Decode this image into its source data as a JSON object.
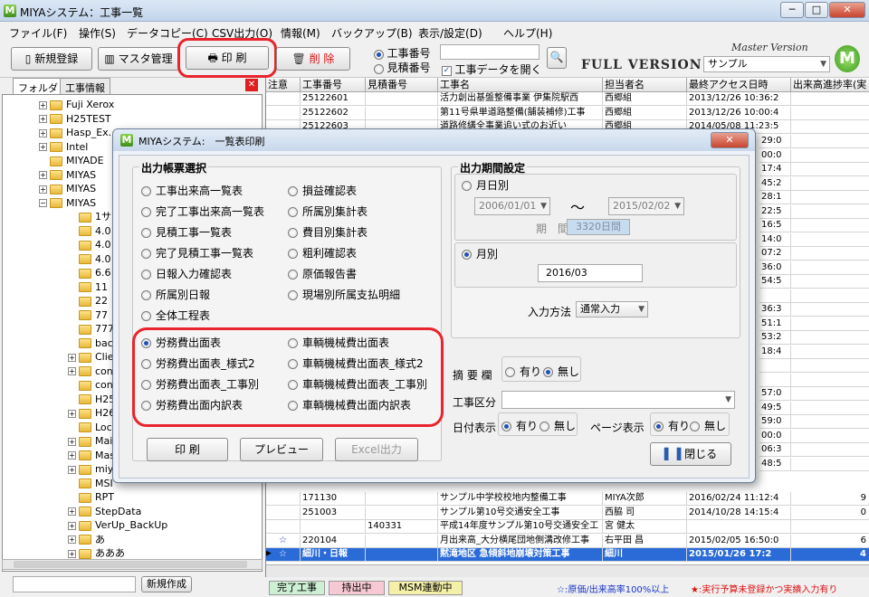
{
  "window": {
    "title": "MIYAシステム：工事一覧",
    "app_icon": "M"
  },
  "menu": [
    "ファイル(F)",
    "操作(S)",
    "データコピー(C)",
    "CSV出力(O)",
    "情報(M)",
    "バックアップ(B)",
    "表示/設定(D)",
    "ヘルプ(H)"
  ],
  "toolbar": {
    "new_label": "新規登録",
    "master_label": "マスタ管理",
    "print_label": "印 刷",
    "delete_label": "削 除",
    "radio_koji": "工事番号",
    "radio_mitsumori": "見積番号",
    "open_check_label": "工事データを開く",
    "search_value": "",
    "brand_top": "Master Version",
    "brand_main": "FULL VERSION",
    "company_value": "サンプル"
  },
  "left": {
    "tabs": [
      "フォルダ",
      "工事情報"
    ],
    "tree": [
      {
        "label": "Fuji Xerox",
        "pm": "+"
      },
      {
        "label": "H25TEST",
        "pm": "+"
      },
      {
        "label": "Hasp_Ex...",
        "pm": "+"
      },
      {
        "label": "Intel",
        "pm": "+"
      },
      {
        "label": "MIYADE",
        "pm": ""
      },
      {
        "label": "MIYAS",
        "pm": "+"
      },
      {
        "label": "MIYAS",
        "pm": "+"
      },
      {
        "label": "MIYAS",
        "pm": "−"
      },
      {
        "label": "1サ",
        "pm": ""
      },
      {
        "label": "4.0",
        "pm": ""
      },
      {
        "label": "4.0",
        "pm": ""
      },
      {
        "label": "4.0",
        "pm": ""
      },
      {
        "label": "6.6",
        "pm": ""
      },
      {
        "label": "11",
        "pm": ""
      },
      {
        "label": "22",
        "pm": ""
      },
      {
        "label": "77",
        "pm": ""
      },
      {
        "label": "777",
        "pm": ""
      },
      {
        "label": "bac",
        "pm": ""
      },
      {
        "label": "Clie",
        "pm": "+"
      },
      {
        "label": "con",
        "pm": "+"
      },
      {
        "label": "con",
        "pm": ""
      },
      {
        "label": "H25",
        "pm": ""
      },
      {
        "label": "H26",
        "pm": "+"
      },
      {
        "label": "Loc",
        "pm": ""
      },
      {
        "label": "Mai",
        "pm": "+"
      },
      {
        "label": "Mas",
        "pm": "+"
      },
      {
        "label": "miy",
        "pm": "+"
      },
      {
        "label": "MSI",
        "pm": ""
      },
      {
        "label": "RPT",
        "pm": ""
      },
      {
        "label": "StepData",
        "pm": "+"
      },
      {
        "label": "VerUp_BackUp",
        "pm": "+"
      },
      {
        "label": "あ",
        "pm": "+"
      },
      {
        "label": "あああ",
        "pm": "+"
      }
    ],
    "new_folder_label": "新規作成"
  },
  "grid": {
    "columns": [
      "注意",
      "工事番号",
      "見積番号",
      "工事名",
      "担当者名",
      "最終アクセス日時",
      "出来高進捗率(実"
    ],
    "rows_top": [
      {
        "mark": "",
        "koji": "25122601",
        "mitsu": "",
        "name": "活力創出基盤整備事業 伊集院駅西",
        "tanto": "西郷組",
        "date": "2013/12/26 10:36:2",
        "rate": ""
      },
      {
        "mark": "",
        "koji": "25122602",
        "mitsu": "",
        "name": "第11号県単道路整備(舗装補修)工事",
        "tanto": "西郷組",
        "date": "2013/12/26 10:00:4",
        "rate": ""
      },
      {
        "mark": "",
        "koji": "25122603",
        "mitsu": "",
        "name": "道路修繕全事業追い式のお近い",
        "tanto": "西郷組",
        "date": "2014/05/08 11:23:5",
        "rate": ""
      }
    ],
    "right_peek": [
      "29:0",
      "00:0",
      "17:4",
      "45:2",
      "28:1",
      "22:5",
      "16:5",
      "14:0",
      "07:2",
      "36:0",
      "54:5",
      "",
      "36:3",
      "51:1",
      "53:2",
      "18:4",
      "",
      "",
      "57:0",
      "49:5",
      "59:0",
      "00:0",
      "06:3",
      "48:5"
    ],
    "rows_bottom": [
      {
        "mark": "",
        "koji": "171130",
        "mitsu": "",
        "name": "サンプル中学校校地内整備工事",
        "tanto": "MIYA次郎",
        "date": "2016/02/24 11:12:4",
        "rate": "9"
      },
      {
        "mark": "",
        "koji": "251003",
        "mitsu": "",
        "name": "サンプル第10号交通安全工事",
        "tanto": "西脇 司",
        "date": "2014/10/28 14:15:4",
        "rate": "0"
      },
      {
        "mark": "",
        "koji": "",
        "mitsu": "140331",
        "name": "平成14年度サンプル第10号交通安全工",
        "tanto": "宮 健太",
        "date": "",
        "rate": ""
      },
      {
        "mark": "☆",
        "koji": "220104",
        "mitsu": "",
        "name": "月出来高_大分横尾団地側溝改修工事",
        "tanto": "右平田 昌",
        "date": "2015/02/05 16:50:0",
        "rate": "6"
      }
    ],
    "selected_row": {
      "mark": "☆",
      "koji": "細川・日報",
      "mitsu": "",
      "name": "黙滝地区 急傾斜地崩壊対策工事",
      "tanto": "細川",
      "date": "2015/01/26 17:2",
      "rate": "4"
    }
  },
  "status": {
    "kanryo": "完了工事",
    "mochidashi": "持出中",
    "msm": "MSM連動中",
    "legend_blue": "☆:原価/出来高率100%以上",
    "legend_red": "★:実行予算未登録かつ実績入力有り"
  },
  "dialog": {
    "title": "MIYAシステム:　一覧表印刷",
    "output_section": "出力帳票選択",
    "options_left": [
      "工事出来高一覧表",
      "完了工事出来高一覧表",
      "見積工事一覧表",
      "完了見積工事一覧表",
      "日報入力確認表",
      "所属別日報",
      "全体工程表"
    ],
    "options_right": [
      "損益確認表",
      "所属別集計表",
      "費目別集計表",
      "粗利確認表",
      "原価報告書",
      "現場別所属支払明細"
    ],
    "highlight_left": [
      "労務費出面表",
      "労務費出面表_様式2",
      "労務費出面表_工事別",
      "労務費出面内訳表"
    ],
    "highlight_right": [
      "車輌機械費出面表",
      "車輌機械費出面表_様式2",
      "車輌機械費出面表_工事別",
      "車輌機械費出面内訳表"
    ],
    "btn_print": "印 刷",
    "btn_preview": "プレビュー",
    "btn_excel": "Excel出力",
    "period_section": "出力期間設定",
    "radio_daily": "月日別",
    "date_from": "2006/01/01",
    "tilde": "～",
    "date_to": "2015/02/02",
    "period_label": "期　間",
    "period_value": "3320日間",
    "radio_monthly": "月別",
    "month_value": "2016/03",
    "input_method_label": "入力方法",
    "input_method_value": "通常入力",
    "tekiyo_label": "摘 要 欄",
    "yes": "有り",
    "no": "無し",
    "kouji_kubun_label": "工事区分",
    "kouji_kubun_value": "",
    "date_show_label": "日付表示",
    "page_show_label": "ページ表示",
    "close_label": "閉じる"
  },
  "colors": {
    "highlight_ring": "#e8242c",
    "selected_row": "#2a6bd8",
    "kanryo_bg": "#cdf0d4",
    "mochidashi_bg": "#f7c9d4",
    "msm_bg": "#f4f0a8"
  }
}
